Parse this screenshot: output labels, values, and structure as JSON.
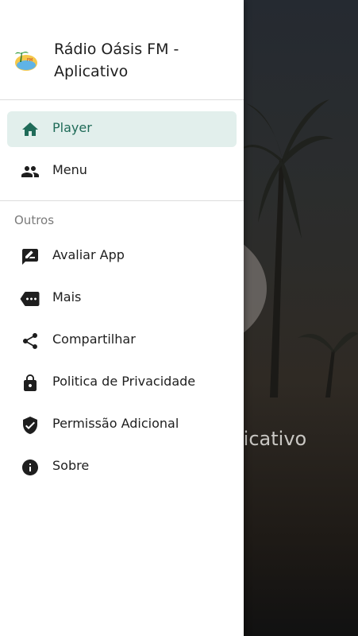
{
  "header": {
    "app_title": "Rádio Oásis FM - Aplicativo"
  },
  "nav": {
    "items": [
      {
        "label": "Player",
        "icon": "home-icon",
        "active": true
      },
      {
        "label": "Menu",
        "icon": "people-icon",
        "active": false
      }
    ]
  },
  "outros": {
    "section_title": "Outros",
    "items": [
      {
        "label": "Avaliar App",
        "icon": "rate-review-icon"
      },
      {
        "label": "Mais",
        "icon": "more-tag-icon"
      },
      {
        "label": "Compartilhar",
        "icon": "share-icon"
      },
      {
        "label": "Politica de Privacidade",
        "icon": "lock-icon"
      },
      {
        "label": "Permissão Adicional",
        "icon": "shield-check-icon"
      },
      {
        "label": "Sobre",
        "icon": "info-icon"
      }
    ]
  },
  "background": {
    "visible_title_fragment": "licativo"
  },
  "colors": {
    "accent": "#1f6b58",
    "active_bg": "#e2efec",
    "drawer_bg": "#ffffff",
    "divider": "#dcdcdc"
  }
}
